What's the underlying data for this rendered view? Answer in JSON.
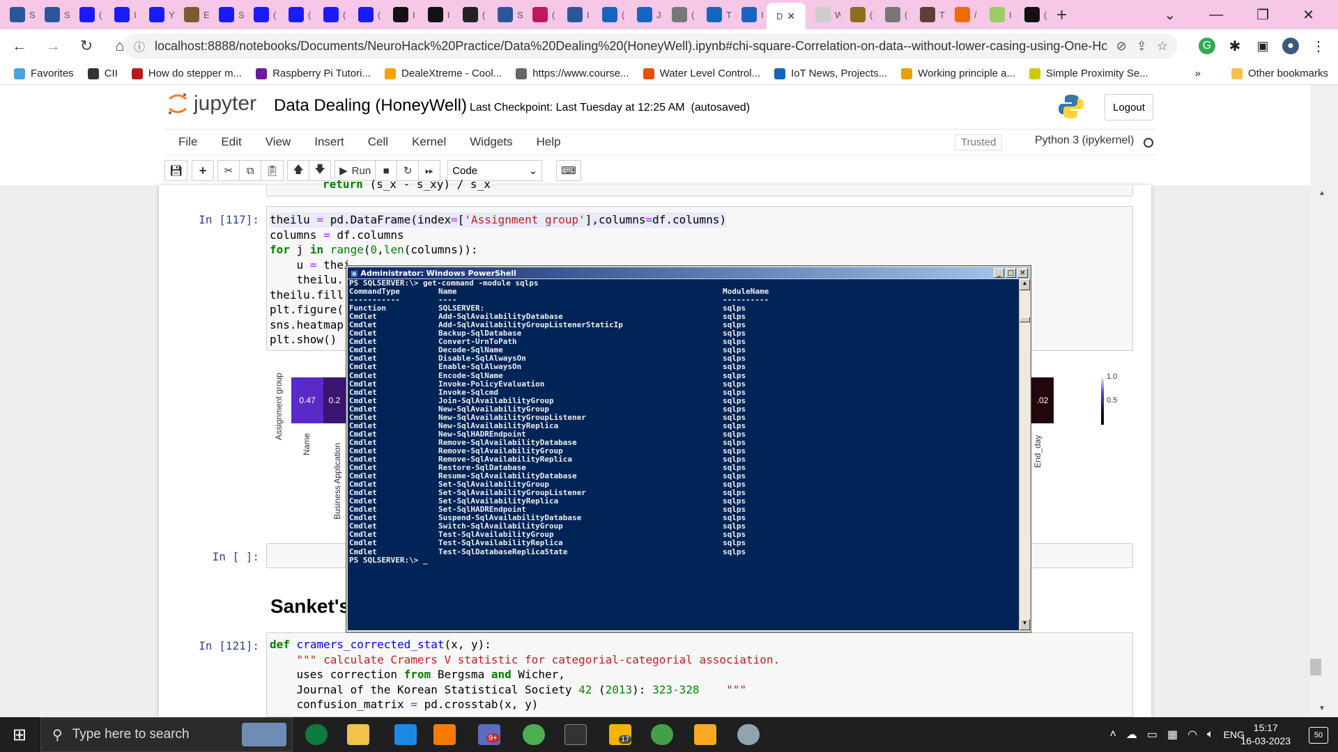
{
  "browser": {
    "tabs": [
      {
        "label": "S",
        "color": "#2b579a"
      },
      {
        "label": "S",
        "color": "#2b579a"
      },
      {
        "label": "(",
        "color": "#1a1aff"
      },
      {
        "label": "I",
        "color": "#1a1aff"
      },
      {
        "label": "Y",
        "color": "#1a1aff"
      },
      {
        "label": "E",
        "color": "#7b5c2e"
      },
      {
        "label": "S",
        "color": "#1a1aff"
      },
      {
        "label": "(",
        "color": "#1a1aff"
      },
      {
        "label": "(",
        "color": "#1a1aff"
      },
      {
        "label": "(",
        "color": "#1a1aff"
      },
      {
        "label": "(",
        "color": "#1a1aff"
      },
      {
        "label": "I",
        "color": "#111111"
      },
      {
        "label": "I",
        "color": "#111111"
      },
      {
        "label": "(",
        "color": "#222222"
      },
      {
        "label": "S",
        "color": "#2b579a"
      },
      {
        "label": "(",
        "color": "#c2185b"
      },
      {
        "label": "I",
        "color": "#2b579a"
      },
      {
        "label": "(",
        "color": "#1565c0"
      },
      {
        "label": "J",
        "color": "#1565c0"
      },
      {
        "label": "(",
        "color": "#777777"
      },
      {
        "label": "T",
        "color": "#1565c0"
      },
      {
        "label": "I",
        "color": "#1565c0"
      }
    ],
    "active_tab": {
      "label": "D",
      "close": "✕"
    },
    "tabs_after": [
      {
        "label": "W3",
        "color": "#cccccc"
      },
      {
        "label": "(",
        "color": "#8d6e1a"
      },
      {
        "label": "(",
        "color": "#777777"
      },
      {
        "label": "T",
        "color": "#5d4037"
      },
      {
        "label": "/",
        "color": "#ef6c00"
      },
      {
        "label": "I",
        "color": "#9ccc65"
      },
      {
        "label": "(",
        "color": "#111111"
      }
    ],
    "new_tab": "+",
    "window_controls": [
      "⌄",
      "—",
      "❐",
      "✕"
    ],
    "url": "localhost:8888/notebooks/Documents/NeuroHack%20Practice/Data%20Dealing%20(HoneyWell).ipynb#chi-square-Correlation-on-data--without-lower-casing-using-One-Hot...",
    "bookmarks": [
      {
        "label": "Favorites",
        "color": "#4aa3df"
      },
      {
        "label": "CII",
        "color": "#333333"
      },
      {
        "label": "How do stepper m...",
        "color": "#b71c1c"
      },
      {
        "label": "Raspberry Pi Tutori...",
        "color": "#6a1b9a"
      },
      {
        "label": "DealeXtreme - Cool...",
        "color": "#f4a300"
      },
      {
        "label": "https://www.course...",
        "color": "#666666"
      },
      {
        "label": "Water Level Control...",
        "color": "#e65100"
      },
      {
        "label": "IoT News, Projects...",
        "color": "#1565c0"
      },
      {
        "label": "Working principle a...",
        "color": "#e6a100"
      },
      {
        "label": "Simple Proximity Se...",
        "color": "#cccc00"
      }
    ],
    "other_bookmarks": "Other bookmarks",
    "more_bookmarks": "»"
  },
  "jupyter": {
    "logo_text": "jupyter",
    "notebook_title": "Data Dealing (HoneyWell)",
    "checkpoint": "Last Checkpoint: Last Tuesday at 12:25 AM  (autosaved)",
    "logout": "Logout",
    "menu": [
      "File",
      "Edit",
      "View",
      "Insert",
      "Cell",
      "Kernel",
      "Widgets",
      "Help"
    ],
    "trusted": "Trusted",
    "kernel": "Python 3 (ipykernel)",
    "toolbar": {
      "run": "Run",
      "cell_type": "Code"
    }
  },
  "cells": {
    "cell117_prompt": "In [117]:",
    "cell_empty_prompt": "In [ ]:",
    "cell121_prompt": "In [121]:",
    "heading": "Sanket's",
    "top_partial_code": "return (s_x - s_xy) / s_x",
    "cell117_lines": [
      "theilu = pd.DataFrame(index=['Assignment group'],columns=df.columns)",
      "columns = df.columns",
      "for j in range(0,len(columns)):",
      "    u = thei",
      "    theilu.",
      "theilu.fill",
      "plt.figure(",
      "sns.heatmap",
      "plt.show()"
    ],
    "cell121_lines": [
      "def cramers_corrected_stat(x, y):",
      "    \"\"\" calculate Cramers V statistic for categorial-categorial association.",
      "    uses correction from Bergsma and Wicher,",
      "    Journal of the Korean Statistical Society 42 (2013): 323-328    \"\"\"",
      "    confusion_matrix = pd.crosstab(x, y)"
    ]
  },
  "heatmap": {
    "ylabel": "Assignment group",
    "cells": [
      {
        "label": "0.47",
        "value": 0.47,
        "color": "#5a2ac8"
      },
      {
        "label": "0.2",
        "value": 0.2,
        "color": "#3a1470"
      },
      {
        "label": ".02",
        "value": 0.02,
        "color": "#22060c"
      }
    ],
    "xticks": [
      "Name",
      "Business Application",
      "End_day"
    ],
    "colorbar_ticks": [
      "1.0",
      "0.5"
    ]
  },
  "powershell": {
    "title": "Administrator: Windows PowerShell",
    "prompt_cmd": "PS SQLSERVER:\\> get-command -module sqlps",
    "headers": [
      "CommandType",
      "Name",
      "ModuleName"
    ],
    "underlines": [
      "-----------",
      "----",
      "----------"
    ],
    "rows": [
      [
        "Function",
        "SQLSERVER:",
        "sqlps"
      ],
      [
        "Cmdlet",
        "Add-SqlAvailabilityDatabase",
        "sqlps"
      ],
      [
        "Cmdlet",
        "Add-SqlAvailabilityGroupListenerStaticIp",
        "sqlps"
      ],
      [
        "Cmdlet",
        "Backup-SqlDatabase",
        "sqlps"
      ],
      [
        "Cmdlet",
        "Convert-UrnToPath",
        "sqlps"
      ],
      [
        "Cmdlet",
        "Decode-SqlName",
        "sqlps"
      ],
      [
        "Cmdlet",
        "Disable-SqlAlwaysOn",
        "sqlps"
      ],
      [
        "Cmdlet",
        "Enable-SqlAlwaysOn",
        "sqlps"
      ],
      [
        "Cmdlet",
        "Encode-SqlName",
        "sqlps"
      ],
      [
        "Cmdlet",
        "Invoke-PolicyEvaluation",
        "sqlps"
      ],
      [
        "Cmdlet",
        "Invoke-Sqlcmd",
        "sqlps"
      ],
      [
        "Cmdlet",
        "Join-SqlAvailabilityGroup",
        "sqlps"
      ],
      [
        "Cmdlet",
        "New-SqlAvailabilityGroup",
        "sqlps"
      ],
      [
        "Cmdlet",
        "New-SqlAvailabilityGroupListener",
        "sqlps"
      ],
      [
        "Cmdlet",
        "New-SqlAvailabilityReplica",
        "sqlps"
      ],
      [
        "Cmdlet",
        "New-SqlHADREndpoint",
        "sqlps"
      ],
      [
        "Cmdlet",
        "Remove-SqlAvailabilityDatabase",
        "sqlps"
      ],
      [
        "Cmdlet",
        "Remove-SqlAvailabilityGroup",
        "sqlps"
      ],
      [
        "Cmdlet",
        "Remove-SqlAvailabilityReplica",
        "sqlps"
      ],
      [
        "Cmdlet",
        "Restore-SqlDatabase",
        "sqlps"
      ],
      [
        "Cmdlet",
        "Resume-SqlAvailabilityDatabase",
        "sqlps"
      ],
      [
        "Cmdlet",
        "Set-SqlAvailabilityGroup",
        "sqlps"
      ],
      [
        "Cmdlet",
        "Set-SqlAvailabilityGroupListener",
        "sqlps"
      ],
      [
        "Cmdlet",
        "Set-SqlAvailabilityReplica",
        "sqlps"
      ],
      [
        "Cmdlet",
        "Set-SqlHADREndpoint",
        "sqlps"
      ],
      [
        "Cmdlet",
        "Suspend-SqlAvailabilityDatabase",
        "sqlps"
      ],
      [
        "Cmdlet",
        "Switch-SqlAvailabilityGroup",
        "sqlps"
      ],
      [
        "Cmdlet",
        "Test-SqlAvailabilityGroup",
        "sqlps"
      ],
      [
        "Cmdlet",
        "Test-SqlAvailabilityReplica",
        "sqlps"
      ],
      [
        "Cmdlet",
        "Test-SqlDatabaseReplicaState",
        "sqlps"
      ]
    ],
    "final_prompt": "PS SQLSERVER:\\> _"
  },
  "taskbar": {
    "search_placeholder": "Type here to search",
    "language": "ENG",
    "time": "15:17",
    "date": "16-03-2023",
    "notifications": "50",
    "badge_teams": "9+",
    "badge_mail": "17"
  }
}
